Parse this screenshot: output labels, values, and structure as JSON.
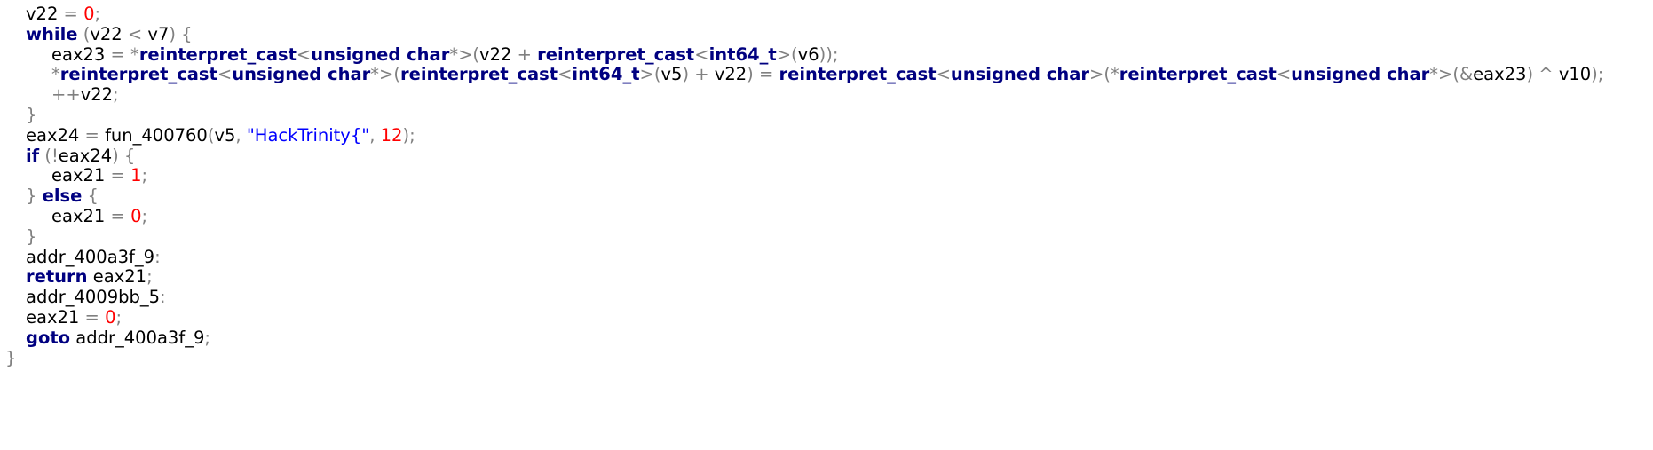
{
  "editor": {
    "theme": {
      "background": "#ffffff",
      "identifier": "#000000",
      "keyword": "#000080",
      "number": "#ff0000",
      "string": "#0000ff",
      "punctuation": "#808080"
    },
    "lines": [
      {
        "indent": 1,
        "tokens": [
          {
            "t": "v22",
            "c": "id"
          },
          {
            "t": " = ",
            "c": "op"
          },
          {
            "t": "0",
            "c": "num"
          },
          {
            "t": ";",
            "c": "op"
          }
        ]
      },
      {
        "indent": 1,
        "tokens": [
          {
            "t": "while",
            "c": "kw"
          },
          {
            "t": " (",
            "c": "op"
          },
          {
            "t": "v22",
            "c": "id"
          },
          {
            "t": " < ",
            "c": "op"
          },
          {
            "t": "v7",
            "c": "id"
          },
          {
            "t": ") {",
            "c": "op"
          }
        ]
      },
      {
        "indent": 2,
        "tokens": [
          {
            "t": "eax23",
            "c": "id"
          },
          {
            "t": " = *",
            "c": "op"
          },
          {
            "t": "reinterpret_cast",
            "c": "kw"
          },
          {
            "t": "<",
            "c": "op"
          },
          {
            "t": "unsigned char",
            "c": "kw"
          },
          {
            "t": "*>(",
            "c": "op"
          },
          {
            "t": "v22",
            "c": "id"
          },
          {
            "t": " + ",
            "c": "op"
          },
          {
            "t": "reinterpret_cast",
            "c": "kw"
          },
          {
            "t": "<",
            "c": "op"
          },
          {
            "t": "int64_t",
            "c": "kw"
          },
          {
            "t": ">(",
            "c": "op"
          },
          {
            "t": "v6",
            "c": "id"
          },
          {
            "t": "));",
            "c": "op"
          }
        ]
      },
      {
        "indent": 2,
        "tokens": [
          {
            "t": "*",
            "c": "op"
          },
          {
            "t": "reinterpret_cast",
            "c": "kw"
          },
          {
            "t": "<",
            "c": "op"
          },
          {
            "t": "unsigned char",
            "c": "kw"
          },
          {
            "t": "*>(",
            "c": "op"
          },
          {
            "t": "reinterpret_cast",
            "c": "kw"
          },
          {
            "t": "<",
            "c": "op"
          },
          {
            "t": "int64_t",
            "c": "kw"
          },
          {
            "t": ">(",
            "c": "op"
          },
          {
            "t": "v5",
            "c": "id"
          },
          {
            "t": ") + ",
            "c": "op"
          },
          {
            "t": "v22",
            "c": "id"
          },
          {
            "t": ") = ",
            "c": "op"
          },
          {
            "t": "reinterpret_cast",
            "c": "kw"
          },
          {
            "t": "<",
            "c": "op"
          },
          {
            "t": "unsigned char",
            "c": "kw"
          },
          {
            "t": ">(*",
            "c": "op"
          },
          {
            "t": "reinterpret_cast",
            "c": "kw"
          },
          {
            "t": "<",
            "c": "op"
          },
          {
            "t": "unsigned char",
            "c": "kw"
          },
          {
            "t": "*>(&",
            "c": "op"
          },
          {
            "t": "eax23",
            "c": "id"
          },
          {
            "t": ") ^ ",
            "c": "op"
          },
          {
            "t": "v10",
            "c": "id"
          },
          {
            "t": ");",
            "c": "op"
          }
        ]
      },
      {
        "indent": 2,
        "tokens": [
          {
            "t": "++",
            "c": "op"
          },
          {
            "t": "v22",
            "c": "id"
          },
          {
            "t": ";",
            "c": "op"
          }
        ]
      },
      {
        "indent": 1,
        "tokens": [
          {
            "t": "}",
            "c": "op"
          }
        ]
      },
      {
        "indent": 1,
        "tokens": [
          {
            "t": "eax24",
            "c": "id"
          },
          {
            "t": " = ",
            "c": "op"
          },
          {
            "t": "fun_400760",
            "c": "id"
          },
          {
            "t": "(",
            "c": "op"
          },
          {
            "t": "v5",
            "c": "id"
          },
          {
            "t": ", ",
            "c": "op"
          },
          {
            "t": "\"HackTrinity{\"",
            "c": "str"
          },
          {
            "t": ", ",
            "c": "op"
          },
          {
            "t": "12",
            "c": "num"
          },
          {
            "t": ");",
            "c": "op"
          }
        ]
      },
      {
        "indent": 1,
        "tokens": [
          {
            "t": "if",
            "c": "kw"
          },
          {
            "t": " (!",
            "c": "op"
          },
          {
            "t": "eax24",
            "c": "id"
          },
          {
            "t": ") {",
            "c": "op"
          }
        ]
      },
      {
        "indent": 2,
        "tokens": [
          {
            "t": "eax21",
            "c": "id"
          },
          {
            "t": " = ",
            "c": "op"
          },
          {
            "t": "1",
            "c": "num"
          },
          {
            "t": ";",
            "c": "op"
          }
        ]
      },
      {
        "indent": 1,
        "tokens": [
          {
            "t": "} ",
            "c": "op"
          },
          {
            "t": "else",
            "c": "kw"
          },
          {
            "t": " {",
            "c": "op"
          }
        ]
      },
      {
        "indent": 2,
        "tokens": [
          {
            "t": "eax21",
            "c": "id"
          },
          {
            "t": " = ",
            "c": "op"
          },
          {
            "t": "0",
            "c": "num"
          },
          {
            "t": ";",
            "c": "op"
          }
        ]
      },
      {
        "indent": 1,
        "tokens": [
          {
            "t": "}",
            "c": "op"
          }
        ]
      },
      {
        "indent": 1,
        "tokens": [
          {
            "t": "addr_400a3f_9",
            "c": "id"
          },
          {
            "t": ":",
            "c": "op"
          }
        ]
      },
      {
        "indent": 1,
        "tokens": [
          {
            "t": "return",
            "c": "kw"
          },
          {
            "t": " ",
            "c": "op"
          },
          {
            "t": "eax21",
            "c": "id"
          },
          {
            "t": ";",
            "c": "op"
          }
        ]
      },
      {
        "indent": 1,
        "tokens": [
          {
            "t": "addr_4009bb_5",
            "c": "id"
          },
          {
            "t": ":",
            "c": "op"
          }
        ]
      },
      {
        "indent": 1,
        "tokens": [
          {
            "t": "eax21",
            "c": "id"
          },
          {
            "t": " = ",
            "c": "op"
          },
          {
            "t": "0",
            "c": "num"
          },
          {
            "t": ";",
            "c": "op"
          }
        ]
      },
      {
        "indent": 1,
        "tokens": [
          {
            "t": "goto",
            "c": "kw"
          },
          {
            "t": " ",
            "c": "op"
          },
          {
            "t": "addr_400a3f_9",
            "c": "id"
          },
          {
            "t": ";",
            "c": "op"
          }
        ]
      },
      {
        "indent": 0,
        "tokens": [
          {
            "t": "}",
            "c": "op"
          }
        ]
      }
    ]
  }
}
